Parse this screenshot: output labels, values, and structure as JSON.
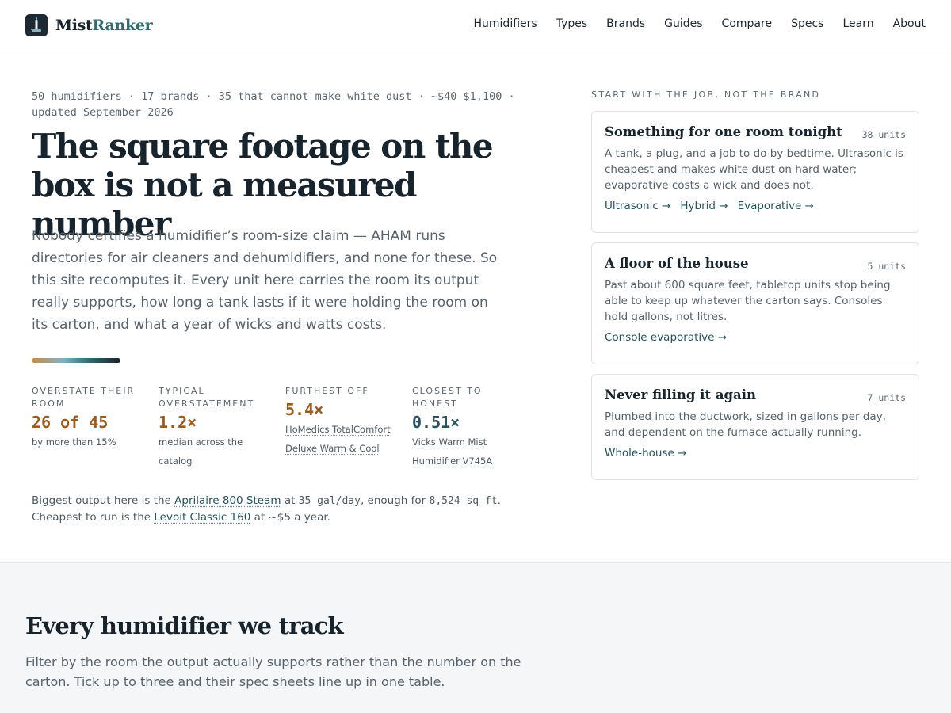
{
  "brand": {
    "name_part1": "Mist",
    "name_part2": "Ranker"
  },
  "nav": {
    "items": [
      "Humidifiers",
      "Types",
      "Brands",
      "Guides",
      "Compare",
      "Specs",
      "Learn",
      "About"
    ]
  },
  "hero": {
    "meta": "50 humidifiers · 17 brands · 35 that cannot make white dust · ~$40–$1,100 · updated September 2026",
    "title": "The square footage on the box is not a measured number",
    "lede": "Nobody certifies a humidifier’s room-size claim — AHAM runs directories for air cleaners and dehumidifiers, and none for these. So this site recomputes it. Every unit here carries the room its output really supports, how long a tank lasts if it were holding the room on its carton, and what a year of wicks and watts costs.",
    "stats": [
      {
        "label": "Overstate their room",
        "value": "26 of 45",
        "note": "by more than 15%"
      },
      {
        "label": "Typical overstatement",
        "value": "1.2×",
        "note": "median across the catalog"
      },
      {
        "label": "Furthest off",
        "value": "5.4×",
        "note": "HoMedics TotalComfort Deluxe Warm & Cool"
      },
      {
        "label": "Closest to honest",
        "value": "0.51×",
        "note": "Vicks Warm Mist Humidifier V745A"
      }
    ],
    "foot": {
      "t1": "Biggest output here is the ",
      "link1": "Aprilaire 800 Steam",
      "t2": " at ",
      "num1": "35 gal/day",
      "t3": ", enough for ",
      "num2": "8,524 sq ft",
      "t4": ". Cheapest to run is the ",
      "link2": "Levoit Classic 160",
      "t5": " at ~$5 a year."
    }
  },
  "side": {
    "heading": "Start with the job, not the brand",
    "cards": [
      {
        "title": "Something for one room tonight",
        "count": "38 units",
        "desc": "A tank, a plug, and a job to do by bedtime. Ultrasonic is cheapest and makes white dust on hard water; evaporative costs a wick and does not.",
        "links": [
          "Ultrasonic →",
          "Hybrid →",
          "Evaporative →"
        ]
      },
      {
        "title": "A floor of the house",
        "count": "5 units",
        "desc": "Past about 600 square feet, tabletop units stop being able to keep up whatever the carton says. Consoles hold gallons, not litres.",
        "links": [
          "Console evaporative →"
        ]
      },
      {
        "title": "Never filling it again",
        "count": "7 units",
        "desc": "Plumbed into the ductwork, sized in gallons per day, and dependent on the furnace actually running.",
        "links": [
          "Whole-house →"
        ]
      }
    ]
  },
  "catalog": {
    "title": "Every humidifier we track",
    "desc": "Filter by the room the output actually supports rather than the number on the carton. Tick up to three and their spec sheets line up in one table."
  },
  "colors": {
    "accent_teal": "#26535e",
    "accent_orange": "#9c5a1d",
    "ink": "#17232d"
  },
  "icons": {
    "logo": "humidifier-mark-icon"
  }
}
